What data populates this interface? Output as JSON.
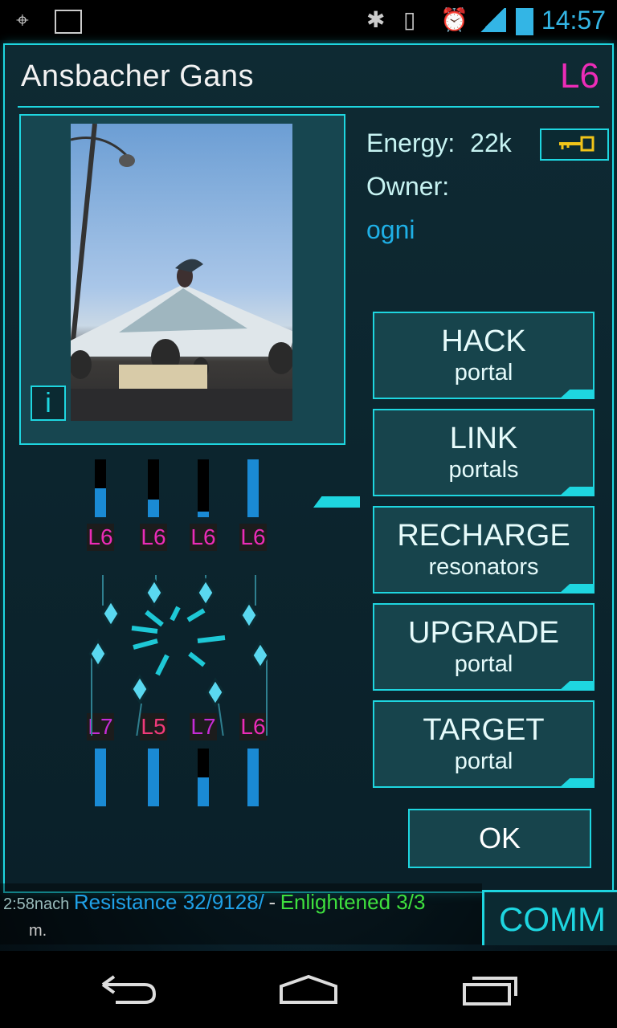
{
  "status_bar": {
    "time": "14:57"
  },
  "portal": {
    "name": "Ansbacher Gans",
    "level": "L6",
    "energy_label": "Energy:",
    "energy_value": "22k",
    "owner_label": "Owner:",
    "owner_name": "ogni",
    "info_label": "i"
  },
  "actions": [
    {
      "main": "HACK",
      "sub": "portal"
    },
    {
      "main": "LINK",
      "sub": "portals"
    },
    {
      "main": "RECHARGE",
      "sub": "resonators"
    },
    {
      "main": "UPGRADE",
      "sub": "portal"
    },
    {
      "main": "TARGET",
      "sub": "portal"
    }
  ],
  "ok_label": "OK",
  "resonators_top": [
    {
      "level": "L6",
      "color": "#ec2cb7",
      "energy": 0.5
    },
    {
      "level": "L6",
      "color": "#ec2cb7",
      "energy": 0.3
    },
    {
      "level": "L6",
      "color": "#ec2cb7",
      "energy": 0.1
    },
    {
      "level": "L6",
      "color": "#ec2cb7",
      "energy": 1.0
    }
  ],
  "resonators_bottom": [
    {
      "level": "L7",
      "color": "#c62cd6",
      "energy": 1.0
    },
    {
      "level": "L5",
      "color": "#f23a7a",
      "energy": 1.0
    },
    {
      "level": "L7",
      "color": "#c62cd6",
      "energy": 0.5
    },
    {
      "level": "L6",
      "color": "#ec2cb7",
      "energy": 1.0
    }
  ],
  "comm": {
    "label": "COMM",
    "chat_line1_prefix": "2:58nach",
    "chat_line1_resistance": "Resistance 32/9128/",
    "chat_line1_sep": "-",
    "chat_line1_enlightened": "Enlightened 3/3",
    "chat_line2": "m."
  },
  "colors": {
    "accent": "#1ed6e0",
    "level": "#ec2cb7",
    "owner": "#1fb0e6"
  }
}
